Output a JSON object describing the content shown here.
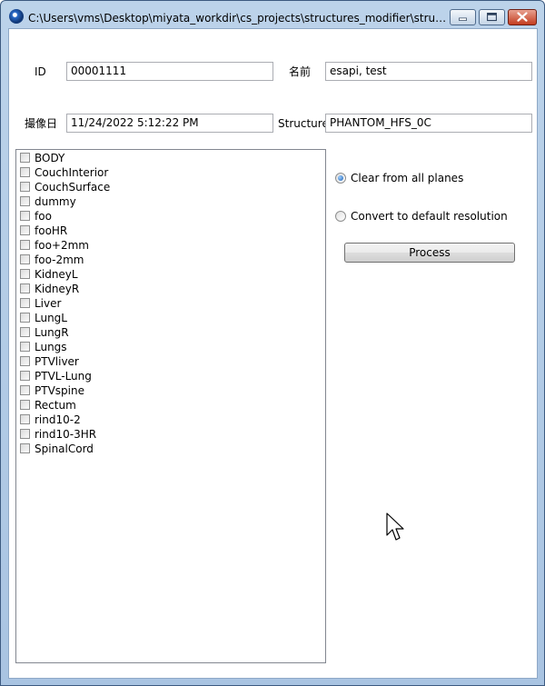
{
  "window": {
    "title": "C:\\Users\\vms\\Desktop\\miyata_workdir\\cs_projects\\structures_modifier\\structures_m...",
    "icons": {
      "app": "app-icon",
      "minimize": "minimize-icon",
      "maximize": "maximize-icon",
      "close": "close-icon"
    }
  },
  "form": {
    "id_label": "ID",
    "id_value": "00001111",
    "name_label": "名前",
    "name_value": "esapi, test",
    "date_label": "撮像日",
    "date_value": "11/24/2022 5:12:22 PM",
    "structure_label": "Structure",
    "structure_value": "PHANTOM_HFS_0C"
  },
  "structures": [
    "BODY",
    "CouchInterior",
    "CouchSurface",
    "dummy",
    "foo",
    "fooHR",
    "foo+2mm",
    "foo-2mm",
    "KidneyL",
    "KidneyR",
    "Liver",
    "LungL",
    "LungR",
    "Lungs",
    "PTVliver",
    "PTVL-Lung",
    "PTVspine",
    "Rectum",
    "rind10-2",
    "rind10-3HR",
    "SpinalCord"
  ],
  "options": {
    "clear_label": "Clear from all planes",
    "clear_selected": true,
    "convert_label": "Convert to default resolution",
    "convert_selected": false
  },
  "process_label": "Process"
}
